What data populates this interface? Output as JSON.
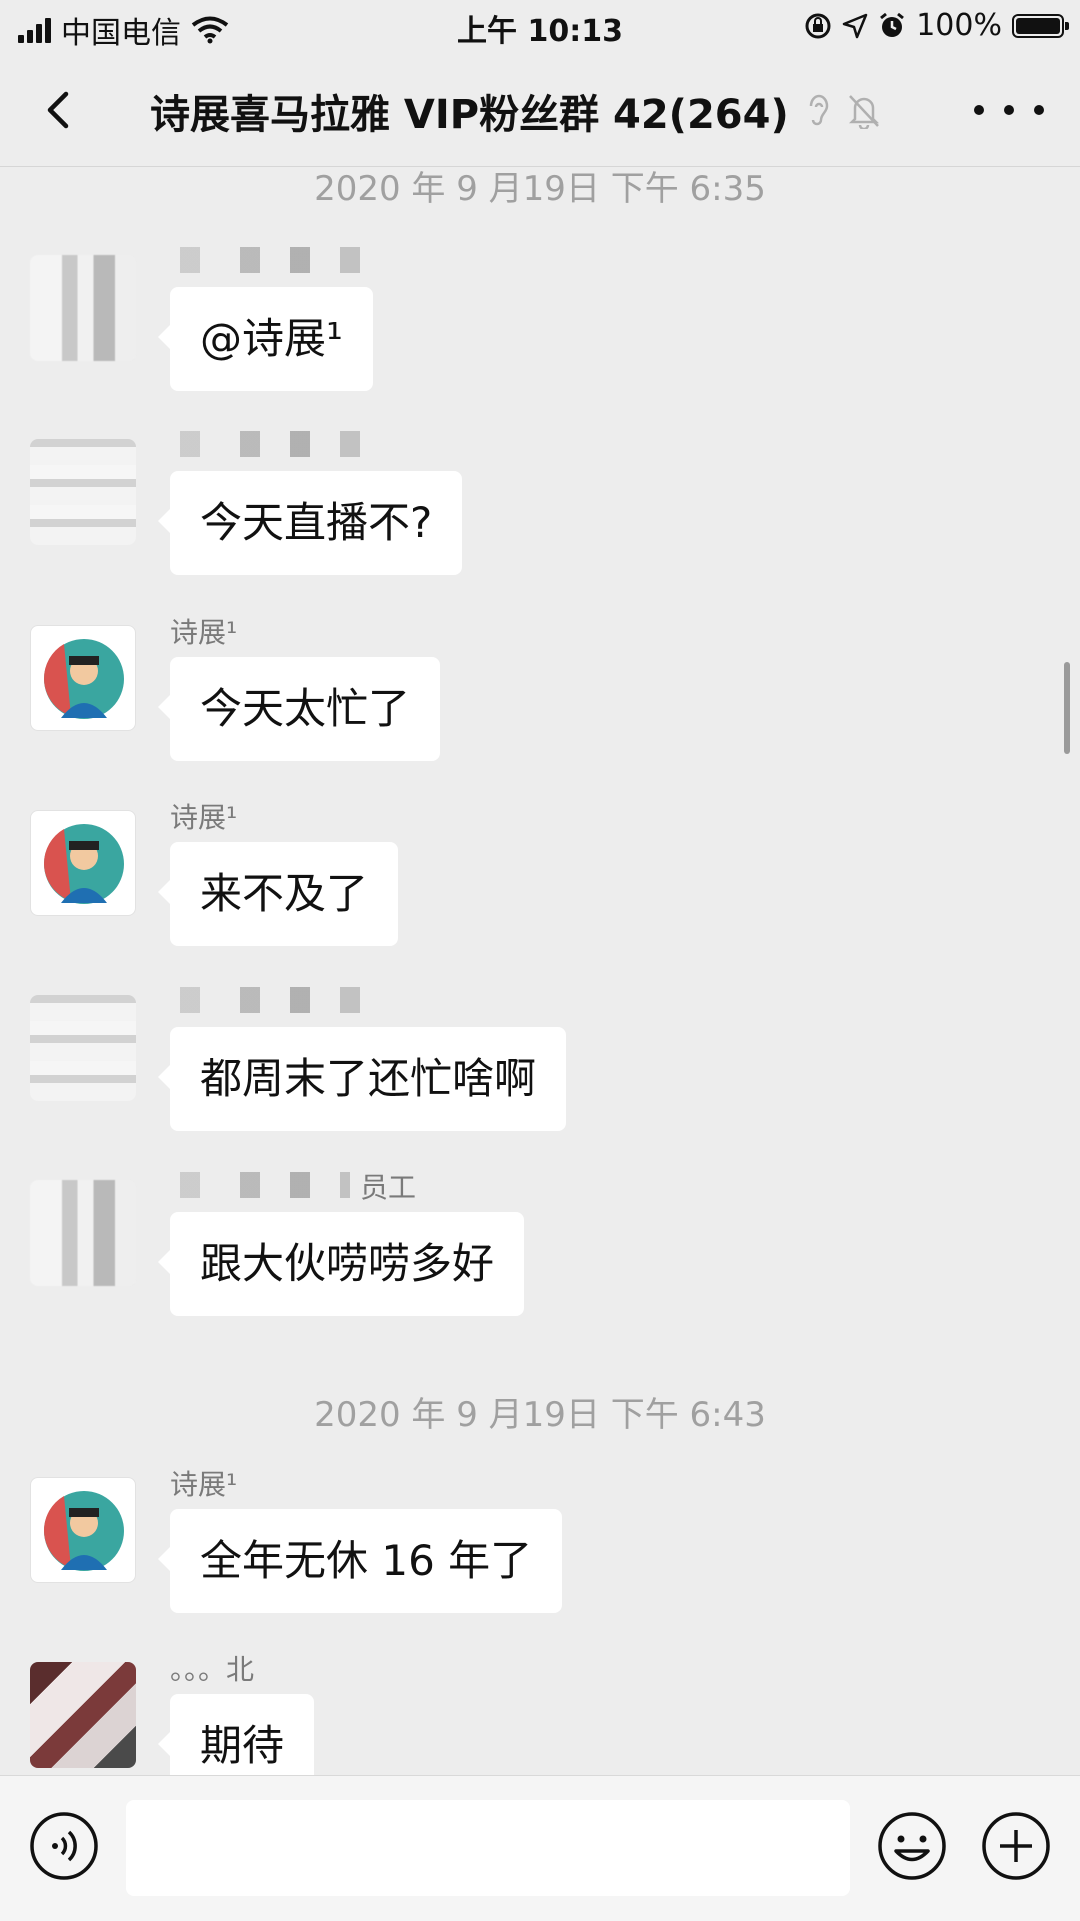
{
  "status_bar": {
    "carrier": "中国电信",
    "time": "上午 10:13",
    "battery": "100%",
    "battery_level": 1.0
  },
  "nav": {
    "title": "诗展喜马拉雅 VIP粉丝群 42(264)"
  },
  "chat": {
    "timestamps": [
      "2020 年 9 月19日 下午 6:35",
      "2020 年 9 月19日 下午 6:43"
    ],
    "messages": [
      {
        "sender": "",
        "text": "@诗展¹"
      },
      {
        "sender": "",
        "text": "今天直播不?"
      },
      {
        "sender": "诗展¹",
        "text": "今天太忙了"
      },
      {
        "sender": "诗展¹",
        "text": "来不及了"
      },
      {
        "sender": "",
        "text": "都周末了还忙啥啊"
      },
      {
        "sender": "员工",
        "text": "跟大伙唠唠多好"
      },
      {
        "sender": "诗展¹",
        "text": "全年无休 16 年了"
      },
      {
        "sender": "。。。北",
        "text": "期待"
      }
    ]
  },
  "input_bar": {
    "placeholder": ""
  },
  "colors": {
    "background": "#ededed",
    "bubble": "#ffffff",
    "timestamp": "#a0a0a0"
  },
  "icons": [
    "back-icon",
    "ear-icon",
    "mute-bell-icon",
    "more-icon",
    "voice-icon",
    "emoji-icon",
    "plus-icon",
    "wifi-icon",
    "signal-icon",
    "battery-icon",
    "alarm-icon",
    "location-icon",
    "lock-rotation-icon"
  ]
}
